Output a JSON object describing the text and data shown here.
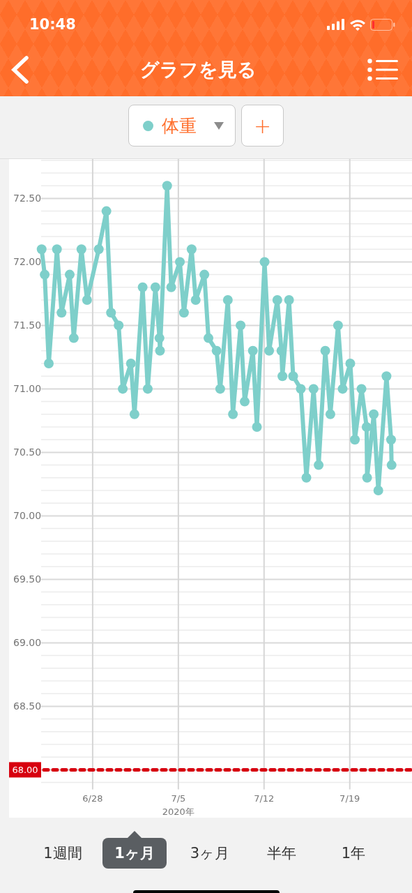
{
  "status_bar": {
    "time": "10:48"
  },
  "header": {
    "title": "グラフを見る"
  },
  "selector": {
    "add_label": "+"
  },
  "graph": {
    "chart_data": {
      "type": "line",
      "xlabel": "2020年",
      "xlim": [
        "2020-06-23T19:00",
        "2020-07-24T02:00"
      ],
      "ylim": [
        67.89,
        72.81
      ],
      "xticks": [
        {
          "value": "2020-06-28",
          "label": "6/28"
        },
        {
          "value": "2020-07-05",
          "label": "7/5"
        },
        {
          "value": "2020-07-12",
          "label": "7/12"
        },
        {
          "value": "2020-07-19",
          "label": "7/19"
        }
      ],
      "yticks": [
        {
          "value": 68.5,
          "label": "68.50"
        },
        {
          "value": 69,
          "label": "69.00"
        },
        {
          "value": 69.5,
          "label": "69.50"
        },
        {
          "value": 70,
          "label": "70.00"
        },
        {
          "value": 70.5,
          "label": "70.50"
        },
        {
          "value": 71,
          "label": "71.00"
        },
        {
          "value": 71.5,
          "label": "71.50"
        },
        {
          "value": 72,
          "label": "72.00"
        },
        {
          "value": 72.5,
          "label": "72.50"
        }
      ],
      "x": [
        "2020-06-23T20:00",
        "2020-06-24T02:00",
        "2020-06-24T10:00",
        "2020-06-25T02:00",
        "2020-06-25T11:00",
        "2020-06-26T03:00",
        "2020-06-26T11:00",
        "2020-06-27T02:00",
        "2020-06-27T13:00",
        "2020-06-28T12:00",
        "2020-06-29T03:00",
        "2020-06-29T12:00",
        "2020-06-30T03:00",
        "2020-06-30T11:00",
        "2020-07-01T03:00",
        "2020-07-01T10:00",
        "2020-07-02T02:00",
        "2020-07-02T12:00",
        "2020-07-03T03:00",
        "2020-07-03T11:00",
        "2020-07-03T12:00",
        "2020-07-04T02:00",
        "2020-07-04T10:00",
        "2020-07-05T03:00",
        "2020-07-05T11:00",
        "2020-07-06T02:00",
        "2020-07-06T10:00",
        "2020-07-07T03:00",
        "2020-07-07T11:00",
        "2020-07-08T03:00",
        "2020-07-08T10:00",
        "2020-07-09T01:00",
        "2020-07-09T11:00",
        "2020-07-10T02:00",
        "2020-07-10T10:00",
        "2020-07-11T02:00",
        "2020-07-11T10:00",
        "2020-07-12T01:00",
        "2020-07-12T10:00",
        "2020-07-13T02:00",
        "2020-07-13T10:00",
        "2020-07-13T12:00",
        "2020-07-14T01:00",
        "2020-07-14T09:00",
        "2020-07-15T00:00",
        "2020-07-15T11:00",
        "2020-07-16T01:00",
        "2020-07-16T11:00",
        "2020-07-17T00:00",
        "2020-07-17T10:00",
        "2020-07-18T01:00",
        "2020-07-18T10:00",
        "2020-07-19T01:00",
        "2020-07-19T10:00",
        "2020-07-19T23:00",
        "2020-07-20T09:00",
        "2020-07-20T10:00",
        "2020-07-20T23:00",
        "2020-07-21T08:00",
        "2020-07-22T00:00",
        "2020-07-22T09:00",
        "2020-07-22T10:00"
      ],
      "series": [
        {
          "name": "体重",
          "color": "#7ecfca",
          "marker": "circle",
          "values": [
            72.1,
            71.9,
            71.2,
            72.1,
            71.6,
            71.9,
            71.4,
            72.1,
            71.7,
            72.1,
            72.4,
            71.6,
            71.5,
            71.0,
            71.2,
            70.8,
            71.8,
            71.0,
            71.8,
            71.4,
            71.3,
            72.6,
            71.8,
            72.0,
            71.6,
            72.1,
            71.7,
            71.9,
            71.4,
            71.3,
            71.0,
            71.7,
            70.8,
            71.5,
            70.9,
            71.3,
            70.7,
            72.0,
            71.3,
            71.7,
            71.3,
            71.1,
            71.7,
            71.1,
            71.0,
            70.3,
            71.0,
            70.4,
            71.3,
            70.8,
            71.5,
            71.0,
            71.2,
            70.6,
            71.0,
            70.7,
            70.3,
            70.8,
            70.2,
            71.1,
            70.6,
            70.4
          ]
        }
      ],
      "grid": true,
      "ref_lines": [
        {
          "axis": "y",
          "value": 68,
          "label": "68.00",
          "color": "#d7000f"
        }
      ]
    }
  },
  "period_tabs": [
    {
      "label": "1週間",
      "selected": false
    },
    {
      "label": "1ヶ月",
      "selected": true
    },
    {
      "label": "3ヶ月",
      "selected": false
    },
    {
      "label": "半年",
      "selected": false
    },
    {
      "label": "1年",
      "selected": false
    }
  ]
}
